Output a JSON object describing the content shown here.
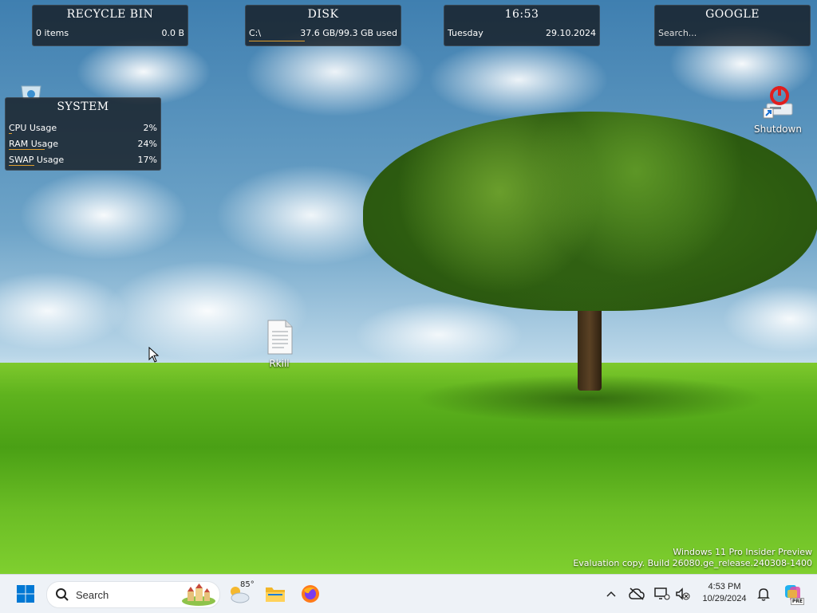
{
  "widgets": {
    "recycle_bin": {
      "title": "RECYCLE BIN",
      "items": "0 items",
      "size": "0.0 B"
    },
    "disk": {
      "title": "DISK",
      "drive": "C:\\",
      "usage": "37.6 GB/99.3 GB used",
      "used_fraction": 0.379
    },
    "clock": {
      "title": "16:53",
      "day": "Tuesday",
      "date": "29.10.2024"
    },
    "google": {
      "title": "GOOGLE",
      "search_placeholder": "Search..."
    },
    "system": {
      "title": "SYSTEM",
      "rows": [
        {
          "label": "CPU Usage",
          "value": "2%",
          "fraction": 0.02
        },
        {
          "label": "RAM Usage",
          "value": "24%",
          "fraction": 0.24
        },
        {
          "label": "SWAP Usage",
          "value": "17%",
          "fraction": 0.17
        }
      ]
    }
  },
  "desktop_icons": {
    "shutdown": "Shutdown",
    "rkill": "Rkill"
  },
  "watermark": {
    "line1": "Windows 11 Pro Insider Preview",
    "line2": "Evaluation copy. Build 26080.ge_release.240308-1400"
  },
  "taskbar": {
    "search_label": "Search",
    "weather_temp": "85°",
    "time": "4:53 PM",
    "date": "10/29/2024",
    "copilot_badge": "PRE"
  },
  "colors": {
    "widget_bg": "#14181e",
    "accent_bar": "#e0a030",
    "taskbar_bg": "#eef2f7",
    "windows_blue": "#0078d4"
  }
}
